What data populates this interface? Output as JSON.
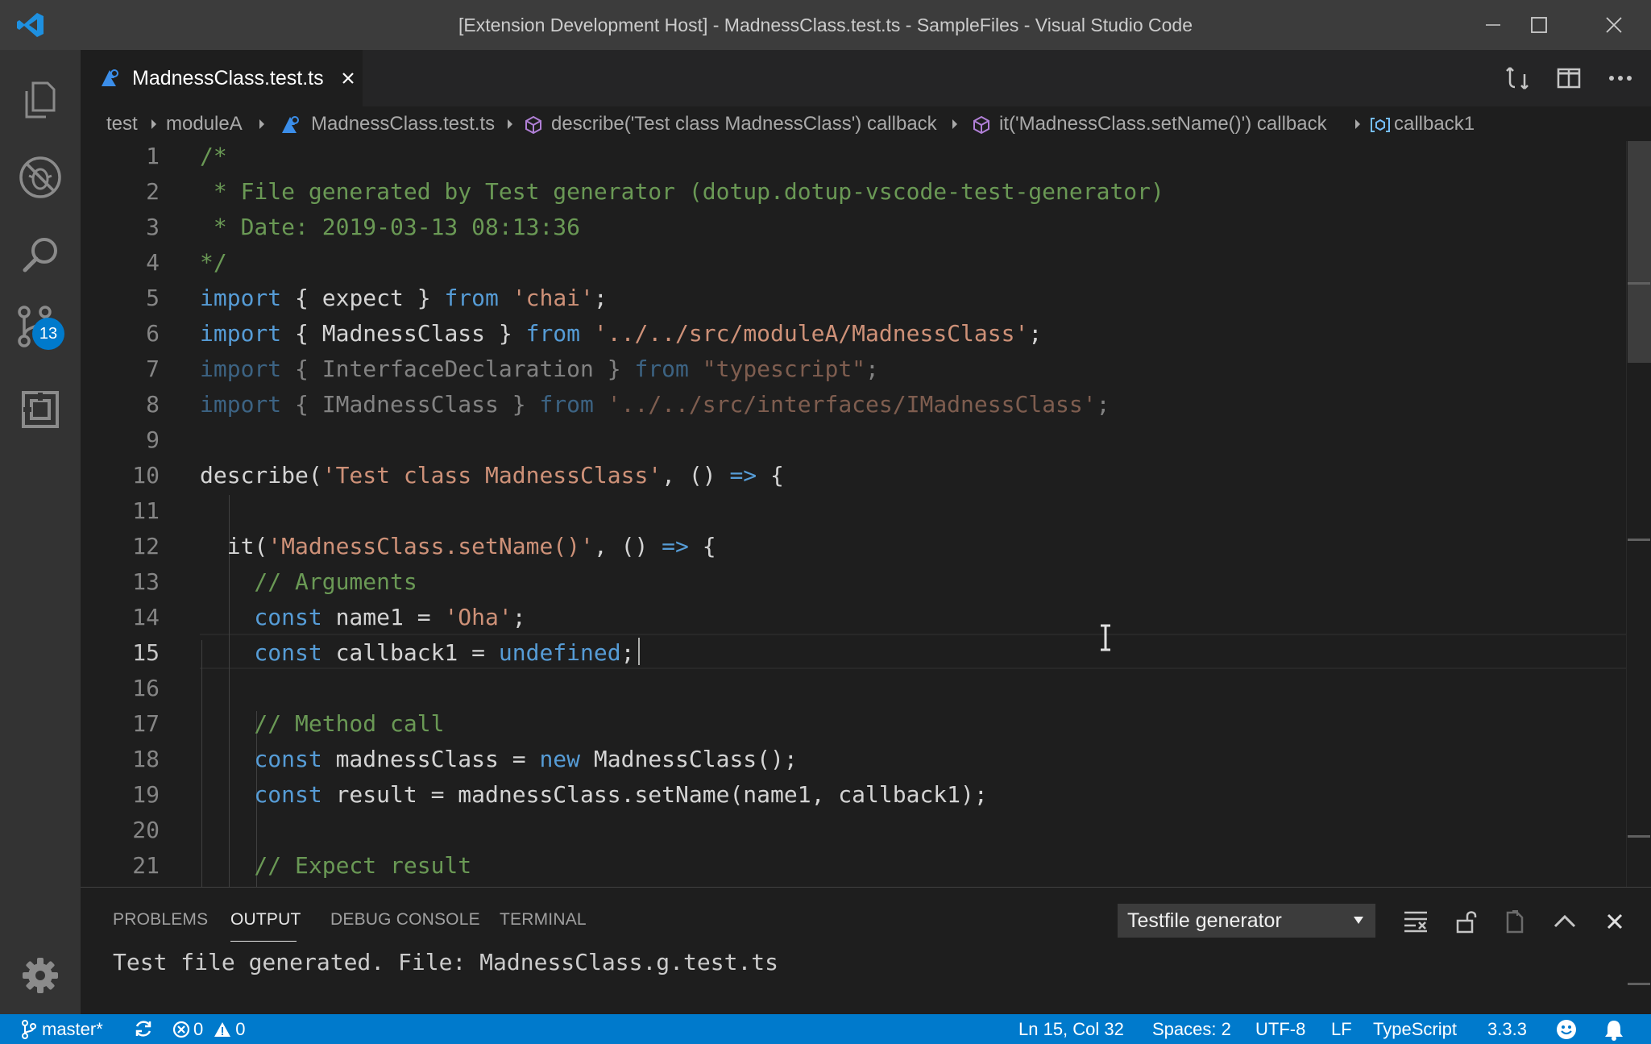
{
  "window": {
    "title": "[Extension Development Host] - MadnessClass.test.ts - SampleFiles - Visual Studio Code"
  },
  "activity_bar": {
    "source_control_badge": "13"
  },
  "tabs": [
    {
      "label": "MadnessClass.test.ts",
      "icon": "typescript-test-file-icon"
    }
  ],
  "breadcrumb": {
    "items": [
      "test",
      "moduleA",
      "MadnessClass.test.ts",
      "describe('Test class MadnessClass') callback",
      "it('MadnessClass.setName()') callback",
      "callback1"
    ]
  },
  "editor": {
    "line_numbers": [
      "1",
      "2",
      "3",
      "4",
      "5",
      "6",
      "7",
      "8",
      "9",
      "10",
      "11",
      "12",
      "13",
      "14",
      "15",
      "16",
      "17",
      "18",
      "19",
      "20",
      "21"
    ],
    "current_line": 15,
    "lines": [
      [
        {
          "t": "c",
          "v": "/*"
        }
      ],
      [
        {
          "t": "c",
          "v": " * File generated by Test generator (dotup.dotup-vscode-test-generator)"
        }
      ],
      [
        {
          "t": "c",
          "v": " * Date: 2019-03-13 08:13:36"
        }
      ],
      [
        {
          "t": "c",
          "v": "*/"
        }
      ],
      [
        {
          "t": "k",
          "v": "import"
        },
        {
          "t": "p",
          "v": " { expect } "
        },
        {
          "t": "k",
          "v": "from"
        },
        {
          "t": "p",
          "v": " "
        },
        {
          "t": "s",
          "v": "'chai'"
        },
        {
          "t": "p",
          "v": ";"
        }
      ],
      [
        {
          "t": "k",
          "v": "import"
        },
        {
          "t": "p",
          "v": " { MadnessClass } "
        },
        {
          "t": "k",
          "v": "from"
        },
        {
          "t": "p",
          "v": " "
        },
        {
          "t": "s",
          "v": "'../../src/moduleA/MadnessClass'"
        },
        {
          "t": "p",
          "v": ";"
        }
      ],
      [
        {
          "t": "k",
          "v": "import",
          "d": 1
        },
        {
          "t": "p",
          "v": " { InterfaceDeclaration } ",
          "d": 1
        },
        {
          "t": "k",
          "v": "from",
          "d": 1
        },
        {
          "t": "p",
          "v": " ",
          "d": 1
        },
        {
          "t": "s",
          "v": "\"typescript\"",
          "d": 1
        },
        {
          "t": "p",
          "v": ";",
          "d": 1
        }
      ],
      [
        {
          "t": "k",
          "v": "import",
          "d": 1
        },
        {
          "t": "p",
          "v": " { IMadnessClass } ",
          "d": 1
        },
        {
          "t": "k",
          "v": "from",
          "d": 1
        },
        {
          "t": "p",
          "v": " ",
          "d": 1
        },
        {
          "t": "s",
          "v": "'../../src/interfaces/IMadnessClass'",
          "d": 1
        },
        {
          "t": "p",
          "v": ";",
          "d": 1
        }
      ],
      [],
      [
        {
          "t": "p",
          "v": "describe("
        },
        {
          "t": "s",
          "v": "'Test class MadnessClass'"
        },
        {
          "t": "p",
          "v": ", () "
        },
        {
          "t": "k",
          "v": "=>"
        },
        {
          "t": "p",
          "v": " {"
        }
      ],
      [],
      [
        {
          "t": "p",
          "v": "  it("
        },
        {
          "t": "s",
          "v": "'MadnessClass.setName()'"
        },
        {
          "t": "p",
          "v": ", () "
        },
        {
          "t": "k",
          "v": "=>"
        },
        {
          "t": "p",
          "v": " {"
        }
      ],
      [
        {
          "t": "c",
          "v": "    // Arguments"
        }
      ],
      [
        {
          "t": "k",
          "v": "    const"
        },
        {
          "t": "p",
          "v": " name1 = "
        },
        {
          "t": "s",
          "v": "'Oha'"
        },
        {
          "t": "p",
          "v": ";"
        }
      ],
      [
        {
          "t": "k",
          "v": "    const"
        },
        {
          "t": "p",
          "v": " callback1 = "
        },
        {
          "t": "k",
          "v": "undefined"
        },
        {
          "t": "p",
          "v": ";"
        }
      ],
      [],
      [
        {
          "t": "c",
          "v": "    // Method call"
        }
      ],
      [
        {
          "t": "k",
          "v": "    const"
        },
        {
          "t": "p",
          "v": " madnessClass = "
        },
        {
          "t": "k",
          "v": "new"
        },
        {
          "t": "p",
          "v": " MadnessClass();"
        }
      ],
      [
        {
          "t": "k",
          "v": "    const"
        },
        {
          "t": "p",
          "v": " result = madnessClass.setName(name1, callback1);"
        }
      ],
      [],
      [
        {
          "t": "c",
          "v": "    // Expect result"
        }
      ]
    ]
  },
  "panel": {
    "tabs": [
      "PROBLEMS",
      "OUTPUT",
      "DEBUG CONSOLE",
      "TERMINAL"
    ],
    "active_tab": "OUTPUT",
    "channel": "Testfile generator",
    "output_text": "Test file generated. File: MadnessClass.g.test.ts"
  },
  "status_bar": {
    "branch": "master*",
    "errors": "0",
    "warnings": "0",
    "position": "Ln 15, Col 32",
    "spaces": "Spaces: 2",
    "encoding": "UTF-8",
    "eol": "LF",
    "language": "TypeScript",
    "version": "3.3.3"
  },
  "colors": {
    "accent": "#007acc",
    "keyword": "#569cd6",
    "string": "#ce9178",
    "comment": "#6a9955"
  }
}
